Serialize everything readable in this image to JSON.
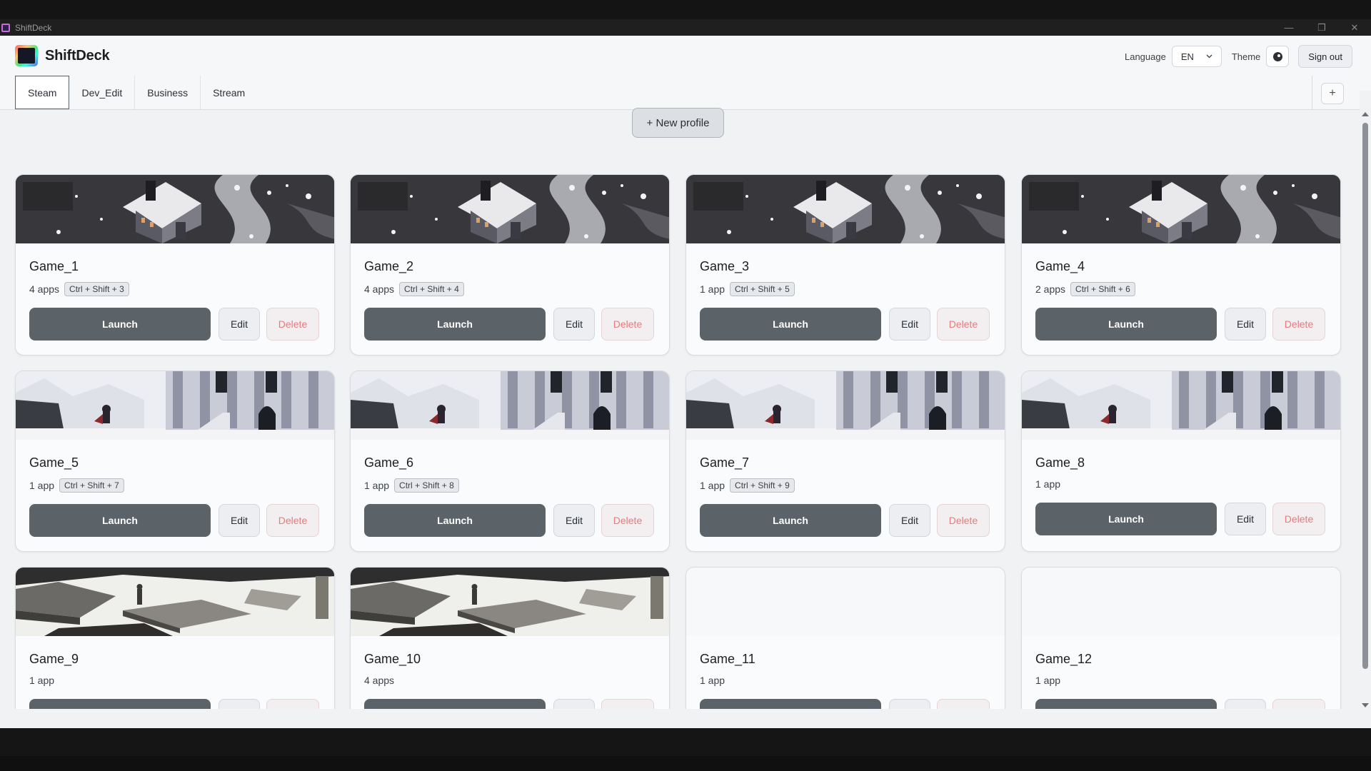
{
  "window": {
    "title": "ShiftDeck",
    "controls": {
      "minimize": "—",
      "restore": "❐",
      "close": "✕"
    }
  },
  "header": {
    "brand": "ShiftDeck",
    "language_label": "Language",
    "language_value": "EN",
    "theme_label": "Theme",
    "signout": "Sign out"
  },
  "tabs": [
    "Steam",
    "Dev_Edit",
    "Business",
    "Stream"
  ],
  "active_tab": "Steam",
  "add_tab": "+",
  "new_profile": "+ New profile",
  "buttons": {
    "launch": "Launch",
    "edit": "Edit",
    "delete": "Delete"
  },
  "profiles": [
    {
      "name": "Game_1",
      "apps": "4 apps",
      "hotkey": "Ctrl + Shift + 3",
      "banner": "snow-cabin"
    },
    {
      "name": "Game_2",
      "apps": "4 apps",
      "hotkey": "Ctrl + Shift + 4",
      "banner": "snow-cabin"
    },
    {
      "name": "Game_3",
      "apps": "1 app",
      "hotkey": "Ctrl + Shift + 5",
      "banner": "snow-cabin"
    },
    {
      "name": "Game_4",
      "apps": "2 apps",
      "hotkey": "Ctrl + Shift + 6",
      "banner": "snow-cabin"
    },
    {
      "name": "Game_5",
      "apps": "1 app",
      "hotkey": "Ctrl + Shift + 7",
      "banner": "snow-castle"
    },
    {
      "name": "Game_6",
      "apps": "1 app",
      "hotkey": "Ctrl + Shift + 8",
      "banner": "snow-castle"
    },
    {
      "name": "Game_7",
      "apps": "1 app",
      "hotkey": "Ctrl + Shift + 9",
      "banner": "snow-castle"
    },
    {
      "name": "Game_8",
      "apps": "1 app",
      "hotkey": "",
      "banner": "snow-castle"
    },
    {
      "name": "Game_9",
      "apps": "1 app",
      "hotkey": "",
      "banner": "stone-ruins"
    },
    {
      "name": "Game_10",
      "apps": "4 apps",
      "hotkey": "",
      "banner": "stone-ruins"
    },
    {
      "name": "Game_11",
      "apps": "1 app",
      "hotkey": "",
      "banner": "blank"
    },
    {
      "name": "Game_12",
      "apps": "1 app",
      "hotkey": "",
      "banner": "blank"
    }
  ],
  "colors": {
    "launch": "#5b6369",
    "delete_text": "#e77a7c",
    "background": "#f1f2f4"
  }
}
